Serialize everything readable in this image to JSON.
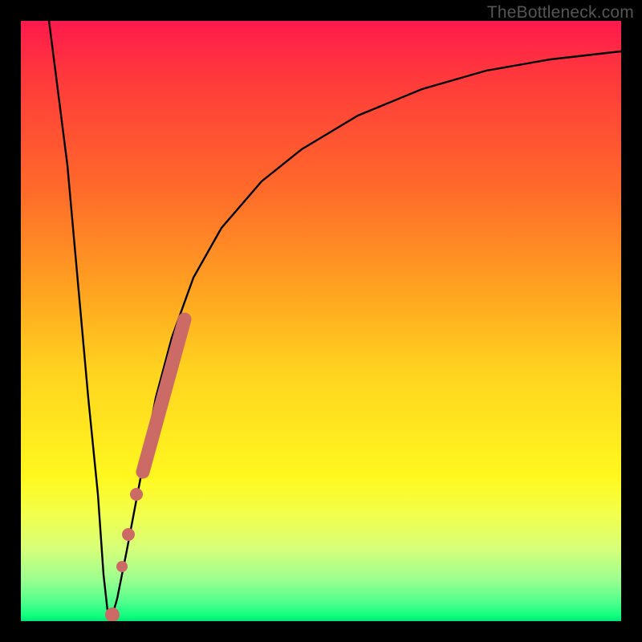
{
  "watermark": "TheBottleneck.com",
  "colors": {
    "frame": "#000000",
    "curve": "#000000",
    "marker": "#cc6a66",
    "gradient_top": "#ff1a4d",
    "gradient_bottom": "#00e876"
  },
  "chart_data": {
    "type": "line",
    "title": "",
    "xlabel": "",
    "ylabel": "",
    "xlim": [
      0,
      100
    ],
    "ylim": [
      0,
      100
    ],
    "grid": false,
    "series": [
      {
        "name": "bottleneck-curve",
        "x": [
          0,
          5,
          10,
          12,
          13,
          14,
          15,
          16,
          18,
          20,
          22,
          25,
          28,
          32,
          38,
          45,
          55,
          65,
          75,
          85,
          95,
          100
        ],
        "values": [
          110,
          70,
          30,
          12,
          4,
          0,
          2,
          10,
          25,
          38,
          48,
          58,
          66,
          73,
          80,
          85,
          90,
          92.5,
          94,
          95,
          95.5,
          96
        ]
      }
    ],
    "markers": [
      {
        "name": "highlight-segment",
        "shape": "thick-line",
        "x_range": [
          20,
          25
        ],
        "y_range": [
          38,
          58
        ]
      },
      {
        "name": "highlight-dot-upper",
        "shape": "dot",
        "x": 18,
        "y": 25
      },
      {
        "name": "highlight-dot-lower",
        "shape": "dot",
        "x": 16,
        "y": 10
      },
      {
        "name": "highlight-dot-min",
        "shape": "dot",
        "x": 14,
        "y": 0
      }
    ]
  }
}
